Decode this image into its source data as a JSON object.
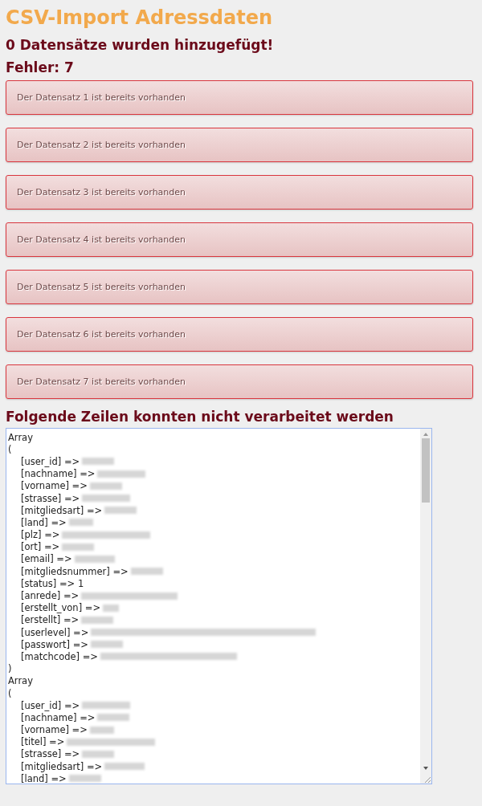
{
  "title": "CSV-Import Adressdaten",
  "added": "0 Datensätze wurden hinzugefügt!",
  "errors_heading": "Fehler: 7",
  "errors": [
    "Der Datensatz 1 ist bereits vorhanden",
    "Der Datensatz 2 ist bereits vorhanden",
    "Der Datensatz 3 ist bereits vorhanden",
    "Der Datensatz 4 ist bereits vorhanden",
    "Der Datensatz 5 ist bereits vorhanden",
    "Der Datensatz 6 ist bereits vorhanden",
    "Der Datensatz 7 ist bereits vorhanden"
  ],
  "failed_heading": "Folgende Zeilen konnten nicht verarbeitet werden",
  "dump": [
    {
      "kind": "plain",
      "text": "Array"
    },
    {
      "kind": "plain",
      "text": "("
    },
    {
      "kind": "field",
      "text": "[user_id] =>",
      "redacted": true
    },
    {
      "kind": "field",
      "text": "[nachname] =>",
      "redacted": true
    },
    {
      "kind": "field",
      "text": "[vorname] =>",
      "redacted": true
    },
    {
      "kind": "field",
      "text": "[strasse] =>",
      "redacted": true
    },
    {
      "kind": "field",
      "text": "[mitgliedsart] =>",
      "redacted": true
    },
    {
      "kind": "field",
      "text": "[land] =>",
      "redacted": true
    },
    {
      "kind": "field",
      "text": "[plz] =>",
      "redacted": true
    },
    {
      "kind": "field",
      "text": "[ort] =>",
      "redacted": true
    },
    {
      "kind": "field",
      "text": "[email] =>",
      "redacted": true
    },
    {
      "kind": "field",
      "text": "[mitgliedsnummer] =>",
      "redacted": true
    },
    {
      "kind": "field",
      "text": "[status] => 1",
      "redacted": false
    },
    {
      "kind": "field",
      "text": "[anrede] =>",
      "redacted": true
    },
    {
      "kind": "field",
      "text": "[erstellt_von] =>",
      "redacted": true
    },
    {
      "kind": "field",
      "text": "[erstellt] =>",
      "redacted": true
    },
    {
      "kind": "field",
      "text": "[userlevel] =>",
      "redacted": true
    },
    {
      "kind": "field",
      "text": "[passwort] =>",
      "redacted": true
    },
    {
      "kind": "field",
      "text": "[matchcode] =>",
      "redacted": true
    },
    {
      "kind": "plain",
      "text": ")"
    },
    {
      "kind": "plain",
      "text": "Array"
    },
    {
      "kind": "plain",
      "text": "("
    },
    {
      "kind": "field",
      "text": "[user_id] =>",
      "redacted": true
    },
    {
      "kind": "field",
      "text": "[nachname] =>",
      "redacted": true
    },
    {
      "kind": "field",
      "text": "[vorname] =>",
      "redacted": true
    },
    {
      "kind": "field",
      "text": "[titel] =>",
      "redacted": true
    },
    {
      "kind": "field",
      "text": "[strasse] =>",
      "redacted": true
    },
    {
      "kind": "field",
      "text": "[mitgliedsart] =>",
      "redacted": true
    },
    {
      "kind": "field",
      "text": "[land] =>",
      "redacted": true
    }
  ]
}
